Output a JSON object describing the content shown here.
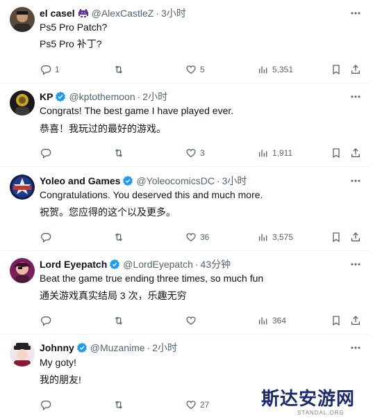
{
  "tweets": [
    {
      "name": "el casel",
      "handle": "@AlexCastleZ",
      "time": "3小时",
      "text1": "Ps5 Pro Patch?",
      "text2": "Ps5 Pro 补丁?",
      "replies": "1",
      "retweets": "",
      "likes": "5",
      "views": "5,351"
    },
    {
      "name": "KP",
      "handle": "@kptothemoon",
      "time": "2小时",
      "text1": "Congrats! The best game I have played ever.",
      "text2": "恭喜！我玩过的最好的游戏。",
      "replies": "",
      "retweets": "",
      "likes": "3",
      "views": "1,911"
    },
    {
      "name": "Yoleo and Games",
      "handle": "@YoleocomicsDC",
      "time": "3小时",
      "text1": "Congratulations. You deserved this and much more.",
      "text2": "祝贺。您应得的这个以及更多。",
      "replies": "",
      "retweets": "",
      "likes": "36",
      "views": "3,575"
    },
    {
      "name": "Lord Eyepatch",
      "handle": "@LordEyepatch",
      "time": "43分钟",
      "text1": "Beat the game true ending three times, so much fun",
      "text2": "通关游戏真实结局 3 次，乐趣无穷",
      "replies": "",
      "retweets": "",
      "likes": "",
      "views": "364"
    },
    {
      "name": "Johnny",
      "handle": "@Muzanime",
      "time": "2小时",
      "text1": "My goty!",
      "text2": "我的朋友!",
      "replies": "",
      "retweets": "",
      "likes": "27",
      "views": ""
    }
  ],
  "separator": "·",
  "watermark": {
    "cn": "斯达安游网",
    "en": "STANDAL.ORG"
  },
  "icons": [
    "reply-icon",
    "retweet-icon",
    "like-icon",
    "views-icon",
    "bookmark-icon",
    "share-icon",
    "more-icon",
    "verified-icon",
    "space-invader-icon"
  ],
  "colors": {
    "text": "#0f1419",
    "muted": "#536471",
    "verified": "#1d9bf0",
    "separator": "#eff3f4"
  }
}
